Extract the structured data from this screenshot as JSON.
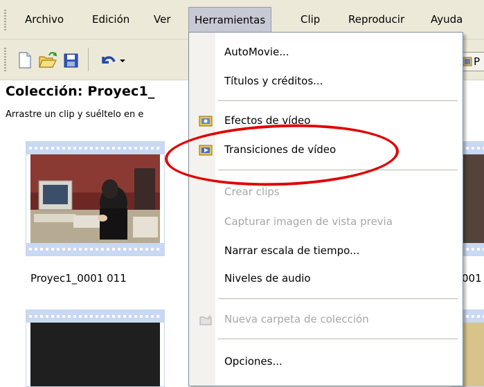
{
  "menubar": {
    "items": [
      "Archivo",
      "Edición",
      "Ver",
      "Herramientas",
      "Clip",
      "Reproducir",
      "Ayuda"
    ],
    "active": "Herramientas"
  },
  "toolbar": {
    "right_button_label": "P"
  },
  "collection": {
    "title": "Colección: Proyec1_",
    "hint": "Arrastre un clip y suéltelo en e"
  },
  "clips": [
    {
      "caption": "Proyec1_0001 011"
    },
    {
      "caption": "001"
    }
  ],
  "dropdown": {
    "items": [
      {
        "label": "AutoMovie...",
        "enabled": true,
        "icon": ""
      },
      {
        "label": "Títulos y créditos...",
        "enabled": true,
        "icon": ""
      },
      {
        "label": "Efectos de vídeo",
        "enabled": true,
        "icon": "video-effects-icon"
      },
      {
        "label": "Transiciones de vídeo",
        "enabled": true,
        "icon": "video-transitions-icon"
      },
      {
        "label": "Crear clips",
        "enabled": false,
        "icon": ""
      },
      {
        "label": "Capturar imagen de vista previa",
        "enabled": false,
        "icon": ""
      },
      {
        "label": "Narrar escala de tiempo...",
        "enabled": true,
        "icon": ""
      },
      {
        "label": "Niveles de audio",
        "enabled": true,
        "icon": ""
      },
      {
        "label": "Nueva carpeta de colección",
        "enabled": false,
        "icon": "new-folder-icon"
      },
      {
        "label": "Opciones...",
        "enabled": true,
        "icon": ""
      }
    ]
  },
  "colors": {
    "annotation": "#e00000",
    "menu_background": "#ece9d8",
    "active_menu": "#c7c9d4"
  }
}
